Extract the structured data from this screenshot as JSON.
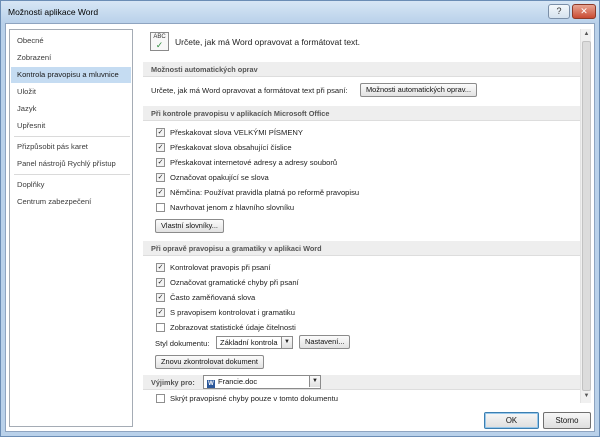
{
  "window": {
    "title": "Možnosti aplikace Word",
    "help_glyph": "?",
    "close_glyph": "✕"
  },
  "sidebar": {
    "items": [
      {
        "label": "Obecné",
        "selected": false
      },
      {
        "label": "Zobrazení",
        "selected": false
      },
      {
        "label": "Kontrola pravopisu a mluvnice",
        "selected": true
      },
      {
        "label": "Uložit",
        "selected": false
      },
      {
        "label": "Jazyk",
        "selected": false
      },
      {
        "label": "Upřesnit",
        "selected": false
      },
      {
        "label": "Přizpůsobit pás karet",
        "selected": false
      },
      {
        "label": "Panel nástrojů Rychlý přístup",
        "selected": false
      },
      {
        "label": "Doplňky",
        "selected": false
      },
      {
        "label": "Centrum zabezpečení",
        "selected": false
      }
    ]
  },
  "header": {
    "icon_text": "ABC",
    "icon_check": "✓",
    "description": "Určete, jak má Word opravovat a formátovat text."
  },
  "autocorrect": {
    "heading": "Možnosti automatických oprav",
    "description": "Určete, jak má Word opravovat a formátovat text při psaní:",
    "button_label": "Možnosti automatických oprav..."
  },
  "office_proofing": {
    "heading": "Při kontrole pravopisu v aplikacích Microsoft Office",
    "options": [
      {
        "label": "Přeskakovat slova VELKÝMI PÍSMENY",
        "checked": true
      },
      {
        "label": "Přeskakovat slova obsahující číslice",
        "checked": true
      },
      {
        "label": "Přeskakovat internetové adresy a adresy souborů",
        "checked": true
      },
      {
        "label": "Označovat opakující se slova",
        "checked": true
      },
      {
        "label": "Němčina: Používat pravidla platná po reformě pravopisu",
        "checked": true
      },
      {
        "label": "Navrhovat jenom z hlavního slovníku",
        "checked": false
      }
    ],
    "dictionaries_button": "Vlastní slovníky..."
  },
  "word_proofing": {
    "heading": "Při opravě pravopisu a gramatiky v aplikaci Word",
    "options": [
      {
        "label": "Kontrolovat pravopis při psaní",
        "checked": true
      },
      {
        "label": "Označovat gramatické chyby při psaní",
        "checked": true
      },
      {
        "label": "Často zaměňovaná slova",
        "checked": true
      },
      {
        "label": "S pravopisem kontrolovat i gramatiku",
        "checked": true
      },
      {
        "label": "Zobrazovat statistické údaje čitelnosti",
        "checked": false
      }
    ],
    "style_label": "Styl dokumentu:",
    "style_value": "Základní kontrola",
    "settings_button": "Nastavení...",
    "recheck_button": "Znovu zkontrolovat dokument"
  },
  "exceptions": {
    "label": "Výjimky pro:",
    "document": "Francie.doc",
    "doc_icon_letter": "W",
    "options": [
      {
        "label": "Skrýt pravopisné chyby pouze v tomto dokumentu",
        "checked": false
      }
    ]
  },
  "footer": {
    "ok_label": "OK",
    "cancel_label": "Storno"
  }
}
